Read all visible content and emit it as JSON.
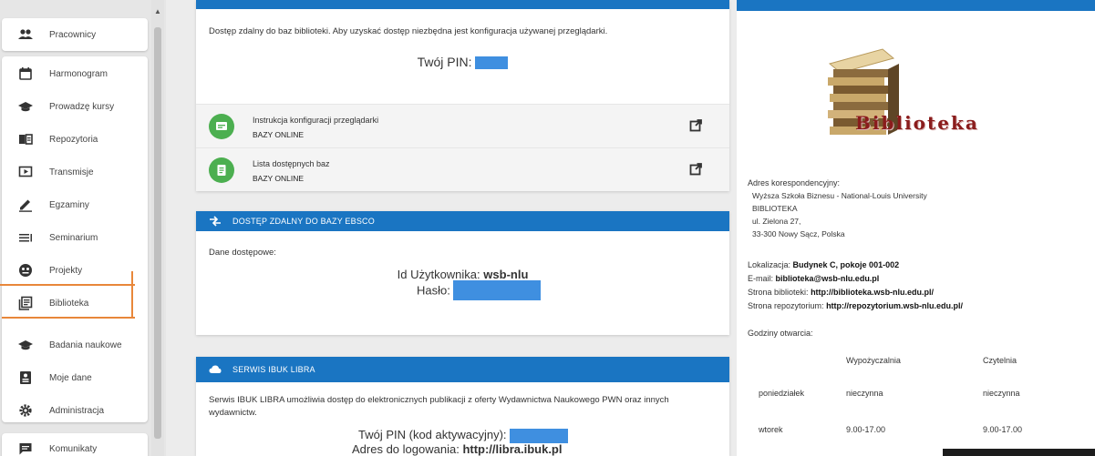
{
  "sidebar": {
    "items": [
      {
        "label": "Pracownicy"
      },
      {
        "label": "Harmonogram"
      },
      {
        "label": "Prowadzę kursy"
      },
      {
        "label": "Repozytoria"
      },
      {
        "label": "Transmisje"
      },
      {
        "label": "Egzaminy"
      },
      {
        "label": "Seminarium"
      },
      {
        "label": "Projekty"
      },
      {
        "label": "Biblioteka"
      },
      {
        "label": "Badania naukowe"
      },
      {
        "label": "Moje dane"
      },
      {
        "label": "Administracja"
      },
      {
        "label": "Komunikaty"
      }
    ]
  },
  "card1": {
    "description": "Dostęp zdalny do baz biblioteki. Aby uzyskać dostęp niezbędna jest konfiguracja używanej przeglądarki.",
    "pin_label": "Twój PIN:",
    "rows": [
      {
        "title": "Instrukcja konfiguracji przeglądarki",
        "subtitle": "BAZY ONLINE"
      },
      {
        "title": "Lista dostępnych baz",
        "subtitle": "BAZY ONLINE"
      }
    ]
  },
  "card2": {
    "title": "DOSTĘP ZDALNY DO BAZY EBSCO",
    "access_label": "Dane dostępowe:",
    "user_label": "Id Użytkownika:",
    "user_value": "wsb-nlu",
    "password_label": "Hasło:"
  },
  "card3": {
    "title": "SERWIS IBUK LIBRA",
    "description_line1": "Serwis IBUK LIBRA umożliwia dostęp do elektronicznych publikacji z oferty Wydawnictwa Naukowego PWN oraz innych",
    "description_line2": "wydawnictw.",
    "pin_label": "Twój PIN (kod aktywacyjny):",
    "login_label": "Adres do logowania:",
    "login_url": "http://libra.ibuk.pl"
  },
  "library": {
    "logo_text": "Biblioteka",
    "address_label": "Adres korespondencyjny:",
    "address_lines": [
      "Wyższa Szkoła Biznesu - National-Louis University",
      "BIBLIOTEKA",
      "ul. Zielona 27,",
      "33-300 Nowy Sącz, Polska"
    ],
    "location_label": "Lokalizacja:",
    "location_value": "Budynek C, pokoje 001-002",
    "email_label": "E-mail:",
    "email_value": "biblioteka@wsb-nlu.edu.pl",
    "site_label": "Strona biblioteki:",
    "site_value": "http://biblioteka.wsb-nlu.edu.pl/",
    "repo_label": "Strona repozytorium:",
    "repo_value": "http://repozytorium.wsb-nlu.edu.pl/",
    "hours_label": "Godziny otwarcia:",
    "hours": {
      "headers": [
        "",
        "Wypożyczalnia",
        "Czytelnia"
      ],
      "rows": [
        [
          "poniedziałek",
          "nieczynna",
          "nieczynna"
        ],
        [
          "wtorek",
          "9.00-17.00",
          "9.00-17.00"
        ]
      ]
    }
  },
  "colors": {
    "primary": "#1a75c2",
    "success": "#4caf50",
    "highlight": "#e8873a"
  }
}
